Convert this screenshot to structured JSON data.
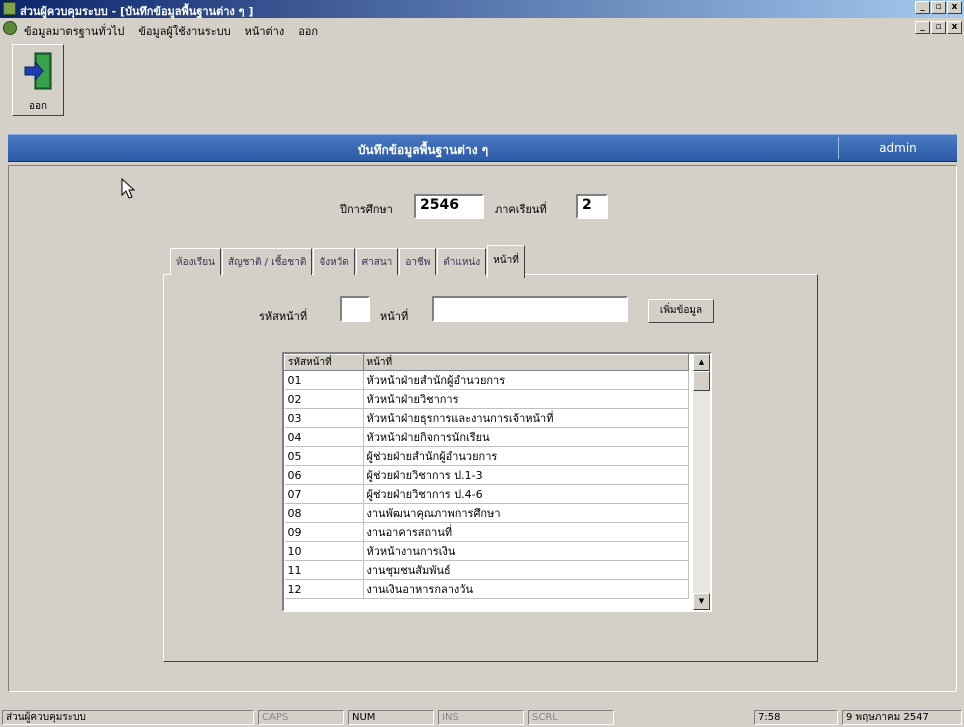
{
  "window": {
    "title": "ส่วนผู้ควบคุมระบบ - [บันทึกข้อมูลพื้นฐานต่าง ๆ ]",
    "min": "_",
    "max": "▫",
    "close": "x"
  },
  "menu": {
    "items": [
      "ข้อมูลมาตรฐานทั่วไป",
      "ข้อมูลผู้ใช้งานระบบ",
      "หน้าต่าง",
      "ออก"
    ]
  },
  "toolbar": {
    "exit_label": "ออก"
  },
  "header": {
    "title": "บันทึกข้อมูลพื้นฐานต่าง ๆ",
    "user": "admin"
  },
  "form": {
    "year_label": "ปีการศึกษา",
    "year_value": "2546",
    "semester_label": "ภาคเรียนที่",
    "semester_value": "2"
  },
  "tabs": [
    "ห้องเรียน",
    "สัญชาติ / เชื้อชาติ",
    "จังหวัด",
    "ศาสนา",
    "อาชีพ",
    "ตำแหน่ง",
    "หน้าที่"
  ],
  "active_tab": "หน้าที่",
  "entry": {
    "code_label": "รหัสหน้าที่",
    "code_value": "",
    "name_label": "หน้าที่",
    "name_value": "",
    "add_button": "เพิ่มข้อมูล"
  },
  "table": {
    "columns": [
      "รหัสหน้าที่",
      "หน้าที่"
    ],
    "rows": [
      [
        "01",
        "หัวหน้าฝ่ายสำนักผู้อำนวยการ"
      ],
      [
        "02",
        "หัวหน้าฝ่ายวิชาการ"
      ],
      [
        "03",
        "หัวหน้าฝ่ายธุรการและงานการเจ้าหน้าที่"
      ],
      [
        "04",
        "หัวหน้าฝ่ายกิจการนักเรียน"
      ],
      [
        "05",
        "ผู้ช่วยฝ่ายสำนักผู้อำนวยการ"
      ],
      [
        "06",
        "ผู้ช่วยฝ่ายวิชาการ ป.1-3"
      ],
      [
        "07",
        "ผู้ช่วยฝ่ายวิชาการ ป.4-6"
      ],
      [
        "08",
        "งานพัฒนาคุณภาพการศึกษา"
      ],
      [
        "09",
        "งานอาคารสถานที่"
      ],
      [
        "10",
        "หัวหน้างานการเงิน"
      ],
      [
        "11",
        "งานชุมชนสัมพันธ์"
      ],
      [
        "12",
        "งานเงินอาหารกลางวัน"
      ]
    ]
  },
  "status": {
    "app": "ส่วนผู้ควบคุมระบบ",
    "caps": "CAPS",
    "num": "NUM",
    "ins": "INS",
    "scrl": "SCRL",
    "time": "7:58",
    "date": "9 พฤษภาคม 2547"
  }
}
